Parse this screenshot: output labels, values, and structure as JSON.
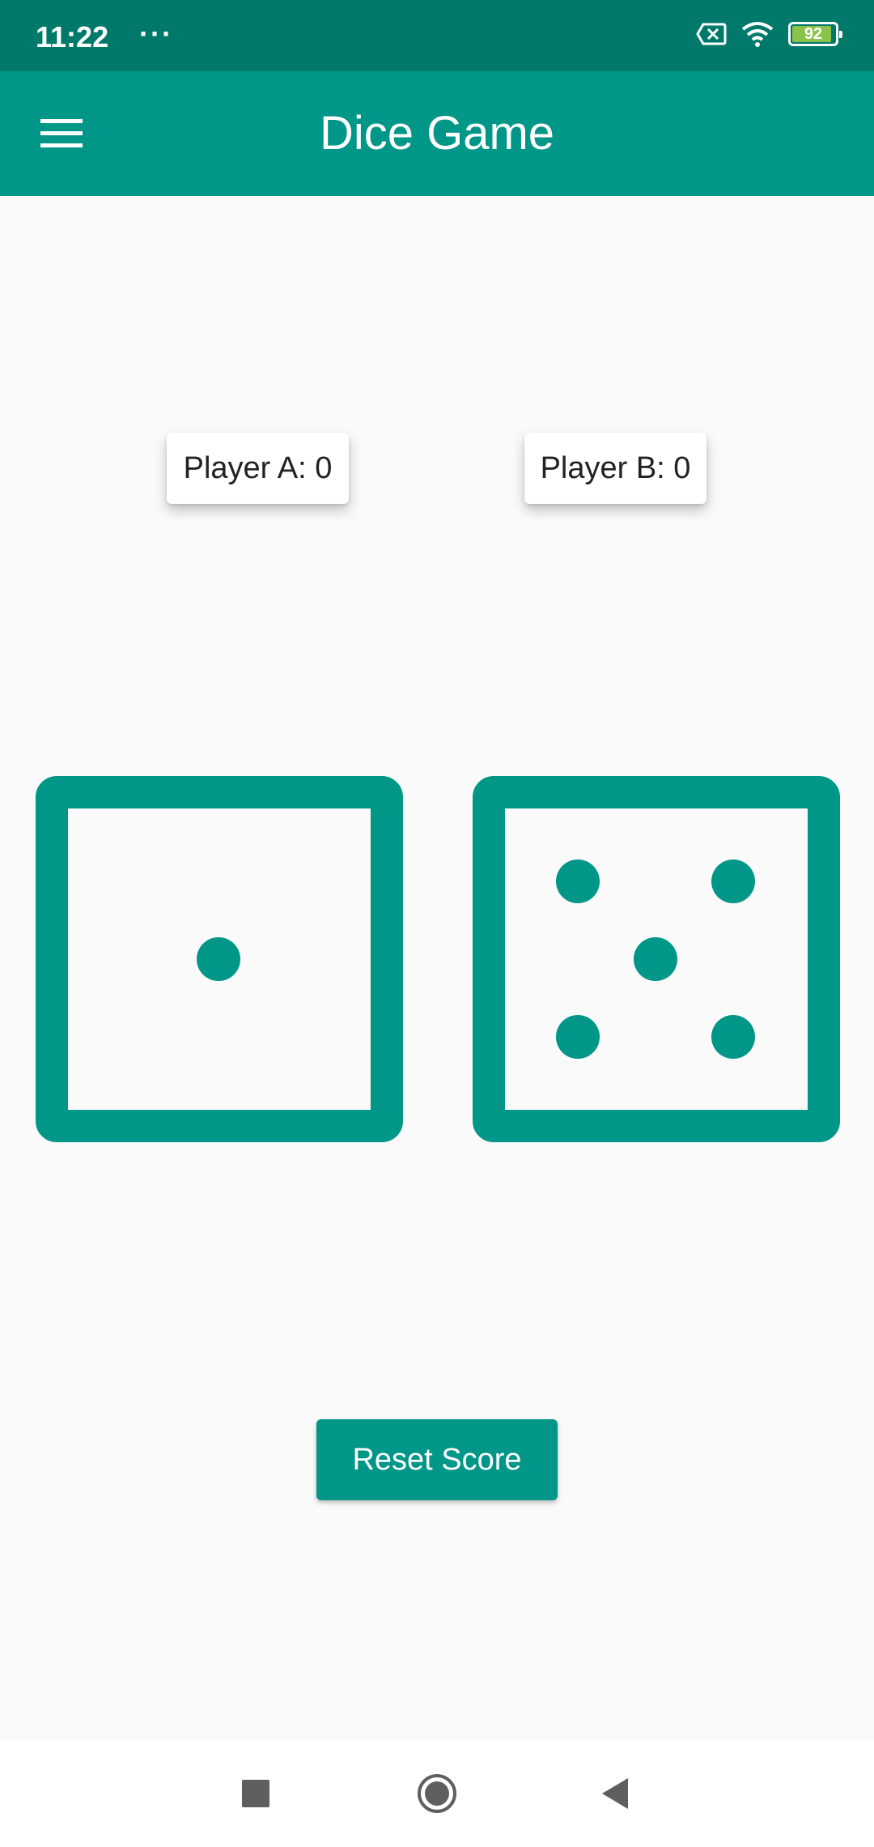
{
  "status_bar": {
    "time": "11:22",
    "overflow": "···",
    "battery_level": "92",
    "icons": [
      "sim-error-icon",
      "wifi-icon",
      "battery-icon"
    ]
  },
  "app_bar": {
    "title": "Dice Game",
    "menu_icon": "hamburger-menu-icon"
  },
  "scores": {
    "player_a": "Player A: 0",
    "player_b": "Player B: 0"
  },
  "dice": {
    "left_value": 1,
    "right_value": 5,
    "color": "#009688"
  },
  "actions": {
    "reset_label": "Reset Score"
  },
  "navigation": {
    "buttons": [
      "recents-square-icon",
      "home-circle-icon",
      "back-triangle-icon"
    ]
  },
  "colors": {
    "primary": "#009688",
    "primary_dark": "#00796b",
    "background": "#fafafa"
  }
}
